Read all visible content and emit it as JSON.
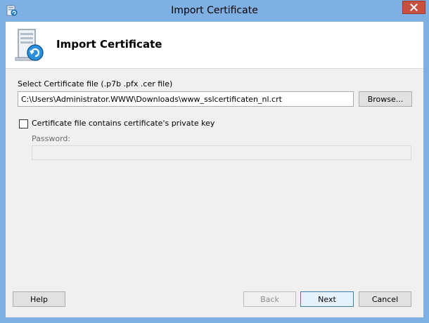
{
  "window": {
    "title": "Import Certificate"
  },
  "header": {
    "title": "Import Certificate",
    "icon": "certificate-server-icon"
  },
  "file_section": {
    "label": "Select Certificate file (.p7b .pfx .cer file)",
    "path_value": "C:\\Users\\Administrator.WWW\\Downloads\\www_sslcertificaten_nl.crt",
    "browse_label": "Browse..."
  },
  "private_key": {
    "checkbox_label": "Certificate file contains certificate's private key",
    "checked": false,
    "password_label": "Password:",
    "password_value": ""
  },
  "footer": {
    "help_label": "Help",
    "back_label": "Back",
    "next_label": "Next",
    "cancel_label": "Cancel"
  },
  "colors": {
    "frame": "#7fb0e3",
    "close_button": "#c7503f",
    "dialog_bg": "#f0f0f0",
    "header_bg": "#ffffff",
    "default_button_border": "#3c7fb1"
  }
}
